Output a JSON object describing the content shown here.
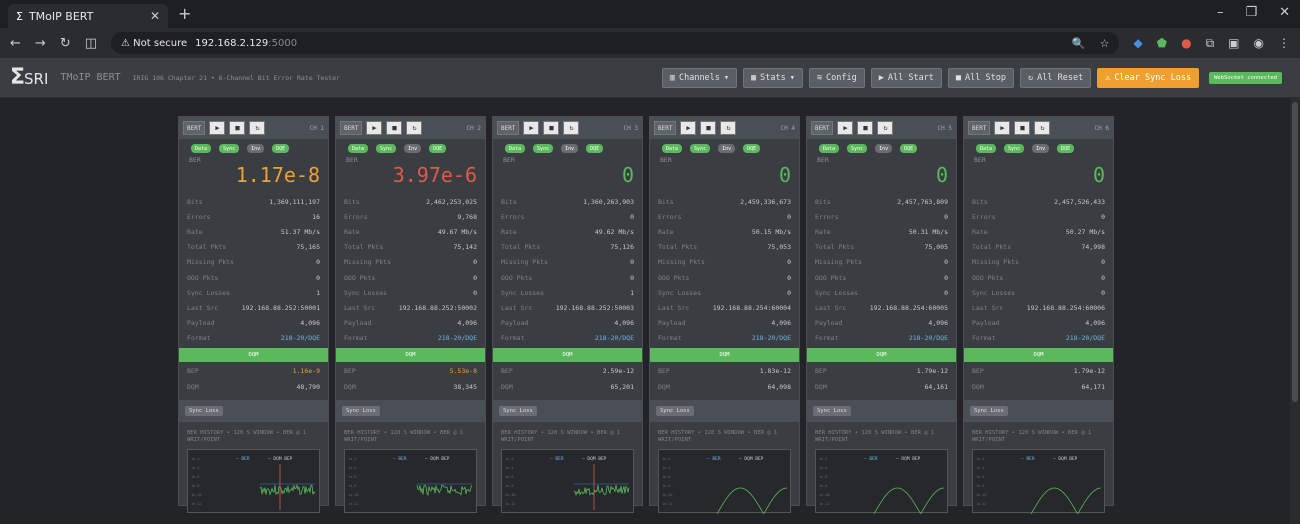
{
  "browser": {
    "tab_title": "TMoIP BERT",
    "tab_icon": "sigma-icon",
    "address_warning": "Not secure",
    "address_host": "192.168.2.129",
    "address_port": ":5000"
  },
  "app": {
    "logo_sigma": "Σ",
    "logo_text": "SRI",
    "title": "TMoIP BERT",
    "subtitle": "IRIG 106 Chapter 21 • 6-Channel Bit Error Rate Tester",
    "toolbar": {
      "channels": "Channels",
      "stats": "Stats",
      "config": "Config",
      "all_start": "All Start",
      "all_stop": "All Stop",
      "all_reset": "All Reset",
      "clear_sync_loss": "Clear Sync Loss",
      "ws": "WebSocket connected"
    }
  },
  "labels": {
    "ber": "BER",
    "bits": "Bits",
    "errors": "Errors",
    "rate": "Rate",
    "total_pkts": "Total Pkts",
    "missing_pkts": "Missing Pkts",
    "ooo_pkts": "OOO Pkts",
    "sync_losses": "Sync Losses",
    "last_src": "Last Src",
    "payload": "Payload",
    "format": "Format",
    "dqm": "DQM",
    "bep": "BEP",
    "sync_loss_btn": "Sync Loss",
    "hist_title": "BER HISTORY • 120 S WINDOW • BER @ 1 WRIT/POINT",
    "legend_ber": "BER",
    "legend_dqm": "DQM BEP",
    "badge_data": "Data",
    "badge_sync": "Sync",
    "badge_inv": "Inv",
    "badge_dqe": "DQE",
    "bert_btn": "BERT"
  },
  "channels": [
    {
      "ch": "CH 1",
      "ber": "1.17e-8",
      "ber_color": "#f0a030",
      "bits": "1,369,111,197",
      "errors": "16",
      "rate": "51.37 Mb/s",
      "total_pkts": "75,165",
      "missing": "0",
      "ooo": "0",
      "sync_losses": "1",
      "last_src": "192.168.88.252:50001",
      "payload": "4,096",
      "format": "218-20/DQE",
      "bep": "1.16e-9",
      "bep_color": "#f0a030",
      "dqm": "48,790"
    },
    {
      "ch": "CH 2",
      "ber": "3.97e-6",
      "ber_color": "#e05a4a",
      "bits": "2,462,253,025",
      "errors": "9,768",
      "rate": "49.67 Mb/s",
      "total_pkts": "75,142",
      "missing": "0",
      "ooo": "0",
      "sync_losses": "0",
      "last_src": "192.168.88.252:50002",
      "payload": "4,096",
      "format": "218-20/DQE",
      "bep": "5.53e-8",
      "bep_color": "#f0a030",
      "dqm": "38,345"
    },
    {
      "ch": "CH 3",
      "ber": "0",
      "ber_color": "#5cb85c",
      "bits": "1,360,263,903",
      "errors": "0",
      "rate": "49.62 Mb/s",
      "total_pkts": "75,126",
      "missing": "0",
      "ooo": "0",
      "sync_losses": "1",
      "last_src": "192.168.88.252:50003",
      "payload": "4,096",
      "format": "218-20/DQE",
      "bep": "2.59e-12",
      "bep_color": "#c5c9ce",
      "dqm": "65,201"
    },
    {
      "ch": "CH 4",
      "ber": "0",
      "ber_color": "#5cb85c",
      "bits": "2,459,336,673",
      "errors": "0",
      "rate": "50.15 Mb/s",
      "total_pkts": "75,053",
      "missing": "0",
      "ooo": "0",
      "sync_losses": "0",
      "last_src": "192.168.88.254:60004",
      "payload": "4,096",
      "format": "218-20/DQE",
      "bep": "1.83e-12",
      "bep_color": "#c5c9ce",
      "dqm": "64,098"
    },
    {
      "ch": "CH 5",
      "ber": "0",
      "ber_color": "#5cb85c",
      "bits": "2,457,763,809",
      "errors": "0",
      "rate": "50.31 Mb/s",
      "total_pkts": "75,005",
      "missing": "0",
      "ooo": "0",
      "sync_losses": "0",
      "last_src": "192.168.88.254:60005",
      "payload": "4,096",
      "format": "218-20/DQE",
      "bep": "1.79e-12",
      "bep_color": "#c5c9ce",
      "dqm": "64,161"
    },
    {
      "ch": "CH 6",
      "ber": "0",
      "ber_color": "#5cb85c",
      "bits": "2,457,526,433",
      "errors": "0",
      "rate": "50.27 Mb/s",
      "total_pkts": "74,998",
      "missing": "0",
      "ooo": "0",
      "sync_losses": "0",
      "last_src": "192.168.88.254:60006",
      "payload": "4,096",
      "format": "218-20/DQE",
      "bep": "1.79e-12",
      "bep_color": "#c5c9ce",
      "dqm": "64,171"
    }
  ]
}
